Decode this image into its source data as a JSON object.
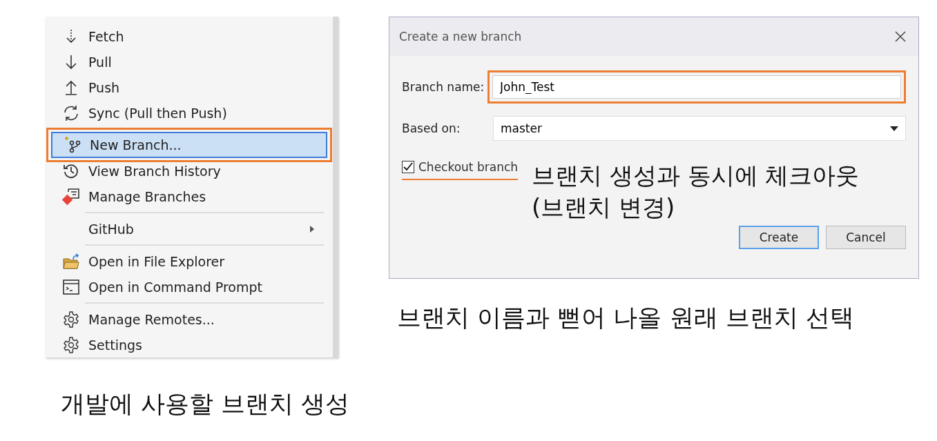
{
  "menu": {
    "items": [
      {
        "kind": "item",
        "label": "Fetch",
        "selected": false,
        "submenu": false,
        "outlined": false
      },
      {
        "kind": "item",
        "label": "Pull",
        "selected": false,
        "submenu": false,
        "outlined": false
      },
      {
        "kind": "item",
        "label": "Push",
        "selected": false,
        "submenu": false,
        "outlined": false
      },
      {
        "kind": "item",
        "label": "Sync (Pull then Push)",
        "selected": false,
        "submenu": false,
        "outlined": false
      },
      {
        "kind": "separator"
      },
      {
        "kind": "item",
        "label": "New Branch...",
        "selected": true,
        "submenu": false,
        "outlined": true
      },
      {
        "kind": "item",
        "label": "View Branch History",
        "selected": false,
        "submenu": false,
        "outlined": false
      },
      {
        "kind": "item",
        "label": "Manage Branches",
        "selected": false,
        "submenu": false,
        "outlined": false
      },
      {
        "kind": "separator"
      },
      {
        "kind": "item",
        "label": "GitHub",
        "selected": false,
        "submenu": true,
        "outlined": false
      },
      {
        "kind": "separator"
      },
      {
        "kind": "item",
        "label": "Open in File Explorer",
        "selected": false,
        "submenu": false,
        "outlined": false
      },
      {
        "kind": "item",
        "label": "Open in Command Prompt",
        "selected": false,
        "submenu": false,
        "outlined": false
      },
      {
        "kind": "separator"
      },
      {
        "kind": "item",
        "label": "Manage Remotes...",
        "selected": false,
        "submenu": false,
        "outlined": false
      },
      {
        "kind": "item",
        "label": "Settings",
        "selected": false,
        "submenu": false,
        "outlined": false
      }
    ],
    "caption": "개발에 사용할 브랜치 생성"
  },
  "dialog": {
    "title": "Create a new branch",
    "branch_name": {
      "label": "Branch name:",
      "value": "John_Test",
      "outlined": true
    },
    "based_on": {
      "label": "Based on:",
      "value": "master"
    },
    "checkout": {
      "label": "Checkout branch",
      "checked": true,
      "underlined": true
    },
    "note": [
      "브랜치 생성과 동시에 체크아웃",
      "(브랜치 변경)"
    ],
    "buttons": [
      {
        "label": "Create",
        "default": true
      },
      {
        "label": "Cancel",
        "default": false
      }
    ],
    "caption": "브랜치 이름과 뻗어 나올 원래 브랜치 선택"
  }
}
